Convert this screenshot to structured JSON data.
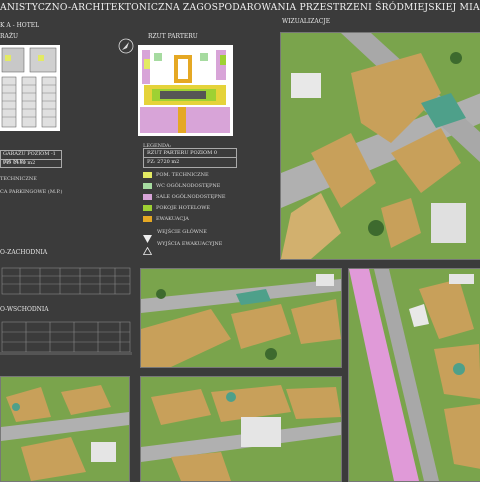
{
  "header": {
    "title": "ANISTYCZNO-ARCHITEKTONICZNA ZAGOSPODAROWANIA PRZESTRZENI ŚRÓDMIEJSKIEJ MIAS",
    "subtitle": "K A - HOTEL"
  },
  "garage": {
    "label": "RAŻU",
    "table_rows": [
      "GARAŻU POZIOM -1 (64 M.P.)",
      "PZ: 2130 m2"
    ],
    "notes": [
      "TECHNICZNE",
      "CA PARKINGOWE (M.P.)"
    ]
  },
  "ground_floor": {
    "label": "RZUT PARTERU",
    "legend_title": "LEGENDA:",
    "table_rows": [
      "RZUT PARTERU POZIOM 0",
      "PZ: 2720 m2"
    ],
    "legend": [
      {
        "color": "#e3ea63",
        "label": "POM. TECHNICZNE"
      },
      {
        "color": "#a6dba0",
        "label": "WC OGÓLNODOSTĘPNE"
      },
      {
        "color": "#d8a4d8",
        "label": "SALE OGÓLNODOSTĘPNE"
      },
      {
        "color": "#9ed133",
        "label": "POKOJE HOTELOWE"
      },
      {
        "color": "#e5a824",
        "label": "EWAKUACJA"
      }
    ],
    "entries": [
      {
        "icon": "filled-triangle-icon",
        "label": "WEJŚCIE GŁÓWNE"
      },
      {
        "icon": "outline-triangle-icon",
        "label": "WYJŚCIA EWAKUACYJNE"
      }
    ]
  },
  "elevations": {
    "nw": "O-ZACHODNIA",
    "ne": "O-WSCHODNIA"
  },
  "visualizations": {
    "label": "WIZUALIZACJE"
  },
  "colors": {
    "background": "#3b3b3b",
    "grass": "#78a04a",
    "building": "#c8a05a",
    "road": "#a8a8a8",
    "pink_street": "#e09ad8"
  }
}
